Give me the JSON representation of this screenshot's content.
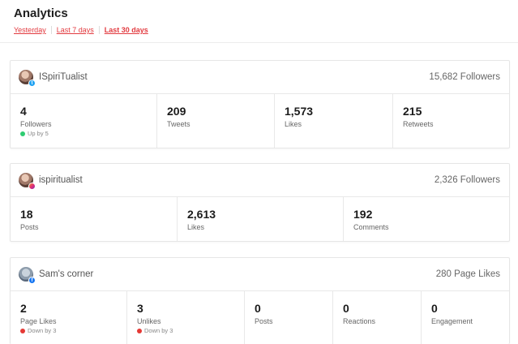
{
  "page": {
    "title": "Analytics"
  },
  "tabs": [
    {
      "label": "Yesterday",
      "active": false
    },
    {
      "label": "Last 7 days",
      "active": false
    },
    {
      "label": "Last 30 days",
      "active": true
    }
  ],
  "accounts": [
    {
      "name": "ISpiriTualist",
      "network_icon": "twitter-icon",
      "summary": "15,682 Followers",
      "stats": [
        {
          "value": "4",
          "label": "Followers",
          "delta": "Up by 5",
          "trend": "up"
        },
        {
          "value": "209",
          "label": "Tweets"
        },
        {
          "value": "1,573",
          "label": "Likes"
        },
        {
          "value": "215",
          "label": "Retweets"
        }
      ]
    },
    {
      "name": "ispiritualist",
      "network_icon": "instagram-icon",
      "summary": "2,326 Followers",
      "stats": [
        {
          "value": "18",
          "label": "Posts"
        },
        {
          "value": "2,613",
          "label": "Likes"
        },
        {
          "value": "192",
          "label": "Comments"
        }
      ]
    },
    {
      "name": "Sam's corner",
      "network_icon": "facebook-icon",
      "summary": "280 Page Likes",
      "stats": [
        {
          "value": "2",
          "label": "Page Likes",
          "delta": "Down by 3",
          "trend": "down"
        },
        {
          "value": "3",
          "label": "Unlikes",
          "delta": "Down by 3",
          "trend": "down"
        },
        {
          "value": "0",
          "label": "Posts"
        },
        {
          "value": "0",
          "label": "Reactions"
        },
        {
          "value": "0",
          "label": "Engagement"
        }
      ]
    }
  ],
  "colors": {
    "accent": "#e23a3f",
    "trend_up": "#2ecc71",
    "trend_down": "#e53935",
    "twitter": "#1da1f2",
    "facebook": "#1877f2"
  }
}
